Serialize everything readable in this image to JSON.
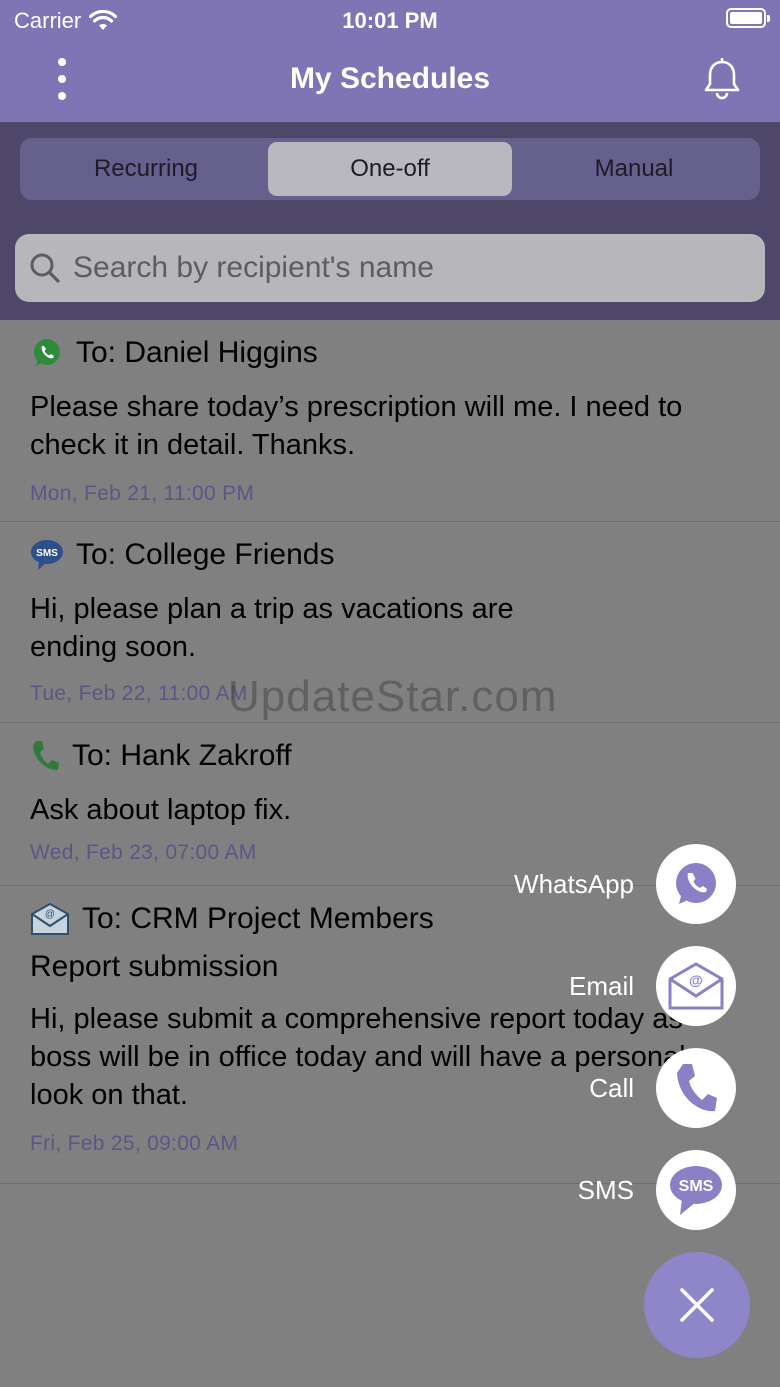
{
  "status_bar": {
    "carrier": "Carrier",
    "time": "10:01 PM"
  },
  "header": {
    "title": "My Schedules"
  },
  "tabs": [
    {
      "label": "Recurring",
      "active": false
    },
    {
      "label": "One-off",
      "active": true
    },
    {
      "label": "Manual",
      "active": false
    }
  ],
  "search": {
    "placeholder": "Search by recipient's name"
  },
  "schedules": [
    {
      "channel": "whatsapp-icon",
      "to": "To: Daniel Higgins",
      "subject": "",
      "body": "Please share today’s prescription will me. I need to check it in detail. Thanks.",
      "date": "Mon, Feb 21, 11:00 PM"
    },
    {
      "channel": "sms-icon",
      "to": "To: College Friends",
      "subject": "",
      "body": "Hi, please plan a trip as vacations are ending soon.",
      "date": "Tue, Feb 22, 11:00 AM"
    },
    {
      "channel": "phone-icon",
      "to": "To: Hank Zakroff",
      "subject": "",
      "body": "Ask about laptop fix.",
      "date": "Wed, Feb 23, 07:00 AM"
    },
    {
      "channel": "email-icon",
      "to": "To: CRM Project Members",
      "subject": "Report submission",
      "body": "Hi, please submit a comprehensive report today as boss will be in office today and will have a personal look on that.",
      "date": "Fri, Feb 25, 09:00 AM"
    }
  ],
  "watermark": "UpdateStar.com",
  "fab_menu": {
    "whatsapp": "WhatsApp",
    "email": "Email",
    "call": "Call",
    "sms": "SMS"
  },
  "colors": {
    "accent": "#7f74b4",
    "fab_icon": "#8b80c6",
    "date": "#5b5685"
  }
}
